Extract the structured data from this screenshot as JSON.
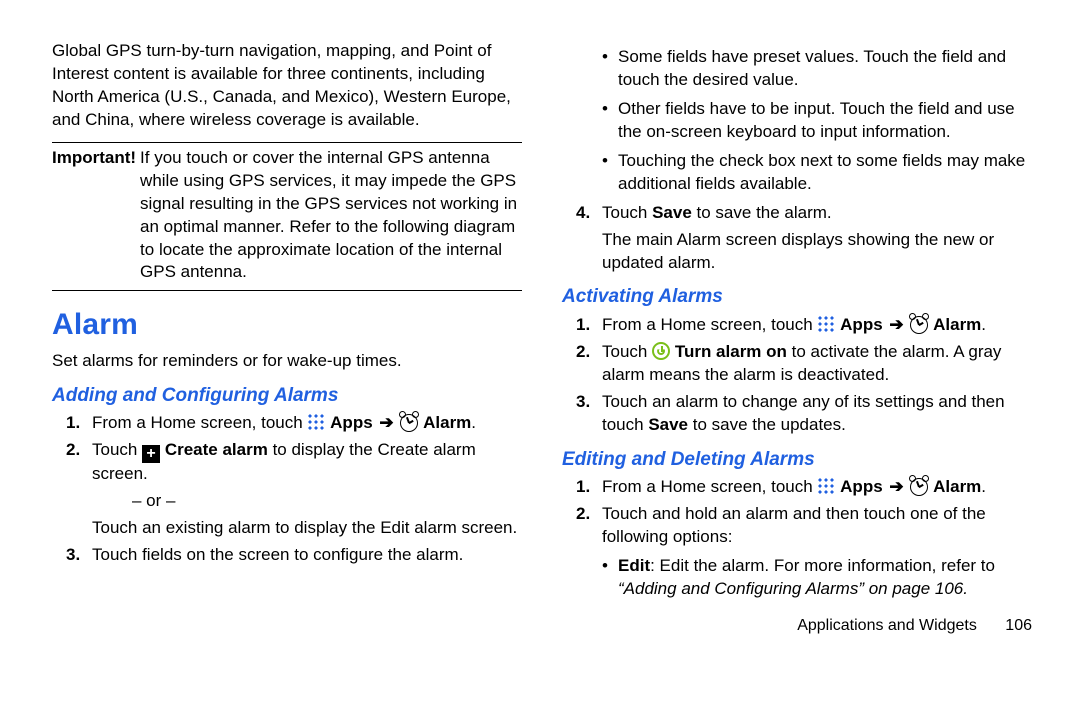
{
  "left": {
    "intro": "Global GPS turn-by-turn navigation, mapping, and Point of Interest content is available for three continents, including North America (U.S., Canada, and Mexico), Western Europe, and China, where wireless coverage is available.",
    "note_label": "Important!",
    "note_body": "If you touch or cover the internal GPS antenna while using GPS services, it may impede the GPS signal resulting in the GPS services not working in an optimal manner. Refer to the following diagram to locate the approximate location of the internal GPS antenna.",
    "h1": "Alarm",
    "alarm_intro": "Set alarms for reminders or for wake-up times.",
    "h2": "Adding and Configuring Alarms",
    "step1_pre": "From a Home screen, touch ",
    "apps_label": "Apps",
    "alarm_label": "Alarm",
    "step2a": "Touch ",
    "step2_create": "Create alarm",
    "step2b": " to display the Create alarm screen.",
    "or": "– or –",
    "step2_alt": "Touch an existing alarm to display the Edit alarm screen.",
    "step3": "Touch fields on the screen to configure the alarm."
  },
  "right": {
    "b1": "Some fields have preset values. Touch the field and touch the desired value.",
    "b2": "Other fields have to be input. Touch the field and use the on-screen keyboard to input information.",
    "b3": "Touching the check box next to some fields may make additional fields available.",
    "s4a": "Touch ",
    "save": "Save",
    "s4b": " to save the alarm.",
    "s4_post": "The main Alarm screen displays showing the new or updated alarm.",
    "h2a": "Activating Alarms",
    "act1_pre": "From a Home screen, touch ",
    "apps_label": "Apps",
    "alarm_label": "Alarm",
    "act2a": "Touch ",
    "turnon": "Turn alarm on",
    "act2b": " to activate the alarm. A gray alarm means the alarm is deactivated.",
    "act3": "Touch an alarm to change any of its settings and then touch ",
    "act3_save": "Save",
    "act3b": " to save the updates.",
    "h2b": "Editing and Deleting Alarms",
    "ed1_pre": "From a Home screen, touch ",
    "ed2": "Touch and hold an alarm and then touch one of the following options:",
    "bullet_edit_label": "Edit",
    "bullet_edit_a": ": Edit the alarm. For more information, refer to ",
    "bullet_edit_ref": "“Adding and Configuring Alarms”",
    "bullet_edit_page": " on page 106.",
    "footer_section": "Applications and Widgets",
    "footer_page": "106"
  }
}
